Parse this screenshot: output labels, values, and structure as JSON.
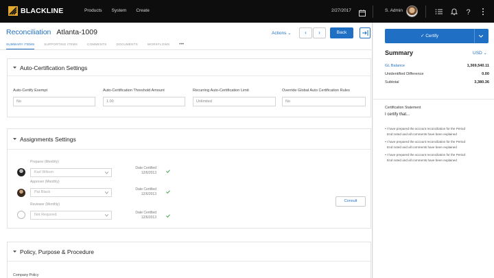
{
  "topbar": {
    "brand": "BLACKLINE",
    "nav": [
      "Products",
      "System",
      "Create"
    ],
    "date": "2/27/2017",
    "user": "S. Admin",
    "icons": [
      "calendar-icon",
      "menu-icon",
      "bell-icon",
      "help-icon",
      "more-vertical-icon"
    ]
  },
  "header": {
    "title": "Reconciliation",
    "account": "Atlanta-1009",
    "actions_label": "Actions",
    "back_label": "Back"
  },
  "tabs": [
    {
      "label": "SUMMARY ITEMS",
      "active": true
    },
    {
      "label": "SUPPORTING ITEMS",
      "active": false
    },
    {
      "label": "COMMENTS",
      "active": false
    },
    {
      "label": "DOCUMENTS",
      "active": false
    },
    {
      "label": "WORKFLOWS",
      "active": false
    },
    {
      "label": "•••",
      "active": false
    }
  ],
  "auto_cert": {
    "title": "Auto-Certification Settings",
    "fields": [
      {
        "label": "Auto-Certify Exempt",
        "value": "No"
      },
      {
        "label": "Auto-Certification Threshold Amount",
        "value": "1.00"
      },
      {
        "label": "Recurring Auto-Certification Limit",
        "value": "Unlimited"
      },
      {
        "label": "Override Global Auto Certification Rules",
        "value": "No"
      }
    ]
  },
  "assignments": {
    "title": "Assignments Settings",
    "rows": [
      {
        "role": "Preparer (Monthly)",
        "person": "Karl Wilson",
        "date_label": "Date Certified",
        "date": "12/6/2013"
      },
      {
        "role": "Approver (Monthly)",
        "person": "Pat Black",
        "date_label": "Date Certified",
        "date": "12/6/2013"
      },
      {
        "role": "Reviewer (Monthly)",
        "person": "Not Required",
        "date_label": "Date Certified",
        "date": "12/6/2013"
      }
    ],
    "consult_label": "Consult"
  },
  "policy": {
    "title": "Policy, Purpose & Procedure",
    "company_policy_label": "Company Policy"
  },
  "right_panel": {
    "certify_label": "✓ Certify",
    "summary_title": "Summary",
    "currency": "USD",
    "rows": [
      {
        "label": "GL Balance",
        "value": "1,369,540.11",
        "link": true
      },
      {
        "label": "Unidentified Difference",
        "value": "0.00",
        "link": false
      },
      {
        "label": "Subtotal",
        "value": "3,380.36",
        "link": false
      }
    ],
    "cert_statement_label": "Certification Statement",
    "cert_intro": "I certify that...",
    "bullets": [
      "• I have prepared the account reconciliation for the Period",
      "  End noted and all comments have been explained",
      "• I have prepared the account reconciliation for the Period",
      "  End noted and all comments have been explained",
      "• I have prepared the account reconciliation for the Period",
      "  End noted and all comments have been explained"
    ]
  },
  "colors": {
    "accent": "#1f6fc5",
    "topbar": "#0d0d0d",
    "check": "#3aa34a"
  }
}
